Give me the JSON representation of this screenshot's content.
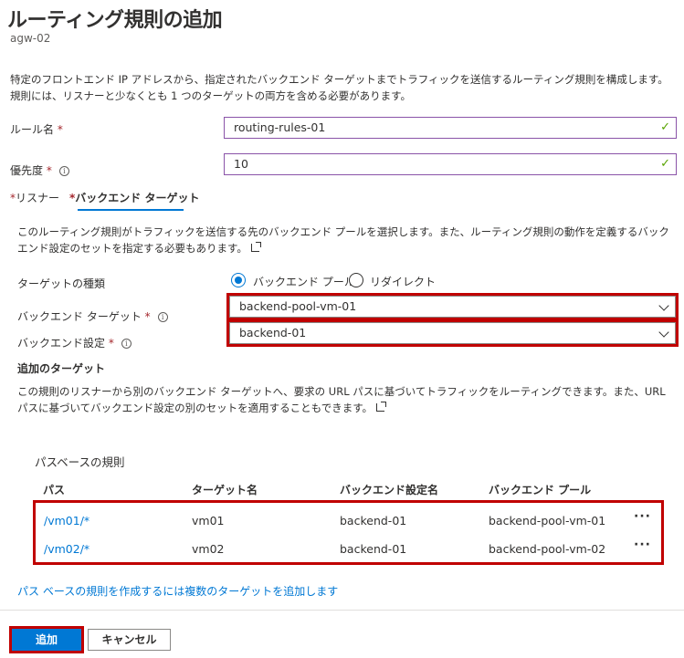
{
  "header": {
    "title": "ルーティング規則の追加",
    "subtitle": "agw-02"
  },
  "description": "特定のフロントエンド IP アドレスから、指定されたバックエンド ターゲットまでトラフィックを送信するルーティング規則を構成します。規則には、リスナーと少なくとも 1 つのターゲットの両方を含める必要があります。",
  "form": {
    "rule_name_label": "ルール名",
    "rule_name_value": "routing-rules-01",
    "priority_label": "優先度",
    "priority_value": "10",
    "required_mark": "*",
    "info_glyph": "i",
    "check_glyph": "✓"
  },
  "tabs": {
    "listener": "リスナー",
    "backend_targets": "バックエンド ターゲット"
  },
  "backend": {
    "description": "このルーティング規則がトラフィックを送信する先のバックエンド プールを選択します。また、ルーティング規則の動作を定義するバックエンド設定のセットを指定する必要もあります。",
    "target_type_label": "ターゲットの種類",
    "option_backend_pool": "バックエンド プール",
    "option_redirect": "リダイレクト",
    "selected_option": "バックエンド プール",
    "backend_target_label": "バックエンド ターゲット",
    "backend_target_value": "backend-pool-vm-01",
    "backend_settings_label": "バックエンド設定",
    "backend_settings_value": "backend-01"
  },
  "additional_targets": {
    "heading": "追加のターゲット",
    "description": "この規則のリスナーから別のバックエンド ターゲットへ、要求の URL パスに基づいてトラフィックをルーティングできます。また、URL パスに基づいてバックエンド設定の別のセットを適用することもできます。"
  },
  "path_rules": {
    "heading": "パスベースの規則",
    "columns": [
      "パス",
      "ターゲット名",
      "バックエンド設定名",
      "バックエンド プール"
    ],
    "rows": [
      {
        "path": "/vm01/*",
        "target": "vm01",
        "settings": "backend-01",
        "pool": "backend-pool-vm-01"
      },
      {
        "path": "/vm02/*",
        "target": "vm02",
        "settings": "backend-01",
        "pool": "backend-pool-vm-02"
      }
    ],
    "more_glyph": "···",
    "add_targets_link": "パス ベースの規則を作成するには複数のターゲットを追加します"
  },
  "footer": {
    "add_button": "追加",
    "cancel_button": "キャンセル"
  },
  "colors": {
    "accent": "#0078d4",
    "highlight_box": "#c00000",
    "valid_check": "#57a300",
    "required": "#a4262c"
  }
}
